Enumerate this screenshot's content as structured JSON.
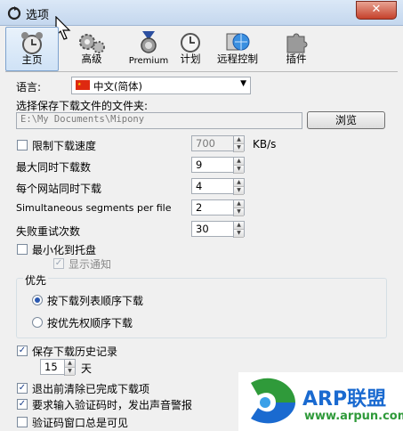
{
  "window": {
    "title": "选项",
    "close_glyph": "✕"
  },
  "toolbar": {
    "items": [
      {
        "label": "主页",
        "icon": "alarm-clock-icon"
      },
      {
        "label": "高级",
        "icon": "gears-icon"
      },
      {
        "label": "Premium",
        "icon": "medal-icon"
      },
      {
        "label": "计划",
        "icon": "clock-icon"
      },
      {
        "label": "远程控制",
        "icon": "remote-globe-icon"
      },
      {
        "label": "插件",
        "icon": "puzzle-icon"
      }
    ]
  },
  "language": {
    "label": "语言:",
    "value": "中文(简体)",
    "flag": "china-flag-icon"
  },
  "folder": {
    "label": "选择保存下载文件的文件夹:",
    "path": "E:\\My Documents\\Mipony",
    "browse_label": "浏览"
  },
  "speed": {
    "label": "限制下载速度",
    "checked": false,
    "value": "700",
    "unit": "KB/s"
  },
  "max_downloads": {
    "label": "最大同时下载数",
    "value": "9"
  },
  "per_site": {
    "label": "每个网站同时下载",
    "value": "4"
  },
  "segments": {
    "label": "Simultaneous segments per file",
    "value": "2"
  },
  "retries": {
    "label": "失败重试次数",
    "value": "30"
  },
  "minimize": {
    "label": "最小化到托盘",
    "checked": false
  },
  "notify": {
    "label": "显示通知",
    "checked": true
  },
  "priority": {
    "title": "优先",
    "options": [
      {
        "label": "按下载列表顺序下载",
        "selected": true
      },
      {
        "label": "按优先权顺序下载",
        "selected": false
      }
    ]
  },
  "history": {
    "label": "保存下载历史记录",
    "checked": true,
    "days": "15",
    "days_unit": "天"
  },
  "clear_on_exit": {
    "label": "退出前清除已完成下载项",
    "checked": true
  },
  "captcha_sound": {
    "label": "要求输入验证码时，发出声音警报",
    "checked": true
  },
  "captcha_visible": {
    "label": "验证码窗口总是可见",
    "checked": false
  },
  "watermark": {
    "brand": "ARP联盟",
    "url": "www.arpun.com"
  },
  "colors": {
    "accent": "#2a58b0",
    "watermark_green": "#2f9a3a",
    "watermark_blue": "#1a6ad0"
  }
}
